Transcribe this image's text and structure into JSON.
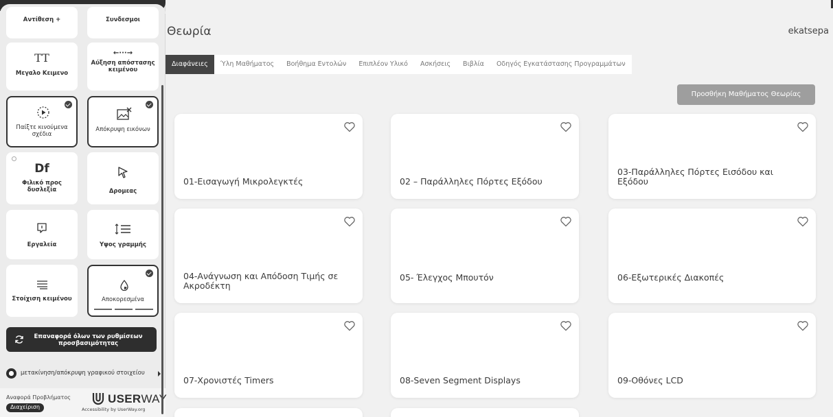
{
  "page": {
    "title": "Θεωρία",
    "username": "ekatsepa"
  },
  "tabs": [
    {
      "label": "Διαφάνειες",
      "active": true
    },
    {
      "label": "Ύλη Μαθήματος",
      "active": false
    },
    {
      "label": "Βοήθημα Εντολών",
      "active": false
    },
    {
      "label": "Επιπλέον Υλικό",
      "active": false
    },
    {
      "label": "Ασκήσεις",
      "active": false
    },
    {
      "label": "Βιβλία",
      "active": false
    },
    {
      "label": "Οδηγός Εγκατάστασης Προγραμμάτων",
      "active": false
    }
  ],
  "add_button": "Προσθήκη Μαθήματος Θεωρίας",
  "cards": [
    {
      "title": "01-Εισαγωγή Μικρολεγκτές"
    },
    {
      "title": "02 – Παράλληλες Πόρτες Εξόδου"
    },
    {
      "title": "03-Παράλληλες Πόρτες Εισόδου και Εξόδου"
    },
    {
      "title": "04-Ανάγνωση και Απόδοση Τιμής σε Ακροδέκτη"
    },
    {
      "title": "05- Έλεγχος Μπουτόν"
    },
    {
      "title": "06-Εξωτερικές Διακοπές"
    },
    {
      "title": "07-Χρονιστές Timers"
    },
    {
      "title": "08-Seven Segment Displays"
    },
    {
      "title": "09-Οθόνες LCD"
    }
  ],
  "sidebar": {
    "tiles": {
      "contrast": "Αντίθεση +",
      "links": "Συνδεσμοι",
      "big_text": "Μεγαλο Κειμενο",
      "big_text_icon": "TT",
      "spacing": "Αύξηση απόστασης κειμένου",
      "spacing_icon": "←···→",
      "animations": "Παίξτε κινούμενα σχέδια",
      "hide_images": "Απόκρυψη εικόνων",
      "dyslexia": "Φιλικό προς δυσλεξία",
      "dyslexia_icon": "Df",
      "cursor": "Δρομεας",
      "tooltips": "Εργαλεία",
      "line_height": "Υψος γραμμής",
      "text_align": "Στοίχιση κειμένου",
      "saturation": "Αποκορεσμένα"
    },
    "reset": "Επαναφορά όλων των ρυθμίσεων προσβασιμότητας",
    "move_hide": "μετακίνηση/απόκρυψη γραφικού στοιχείου",
    "report": "Αναφορά Προβλήματος",
    "manage": "Διαχείριση",
    "brand_strong": "USER",
    "brand_light": "WAY",
    "powered": "Accessibility by UserWay.org"
  },
  "colors": {
    "accent_dark": "#2e2e2e",
    "page_bg": "#f1f1f1",
    "add_button_bg": "#9e9e9e"
  }
}
